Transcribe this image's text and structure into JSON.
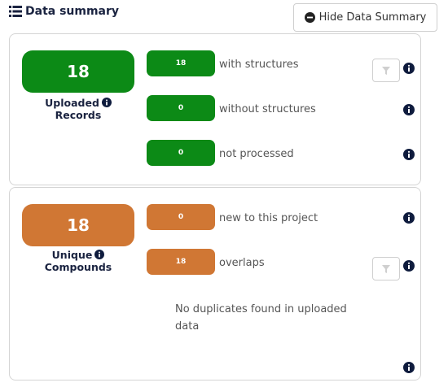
{
  "header": {
    "title": "Data summary",
    "hide_button_label": "Hide Data Summary"
  },
  "records": {
    "total": "18",
    "label_line1": "Uploaded",
    "label_line2": "Records",
    "rows": [
      {
        "count": "18",
        "label": "with structures"
      },
      {
        "count": "0",
        "label": "without structures"
      },
      {
        "count": "0",
        "label": "not processed"
      }
    ]
  },
  "compounds": {
    "total": "18",
    "label_line1": "Unique",
    "label_line2": "Compounds",
    "rows": [
      {
        "count": "0",
        "label": "new to this project"
      },
      {
        "count": "18",
        "label": "overlaps"
      }
    ],
    "duplicates_message": "No duplicates found in uploaded data"
  },
  "colors": {
    "records_accent": "#0c8a16",
    "compounds_accent": "#d07734",
    "text_dark": "#1a2340"
  },
  "icons": [
    "list-icon",
    "minus-circle-icon",
    "info-icon",
    "filter-icon"
  ]
}
